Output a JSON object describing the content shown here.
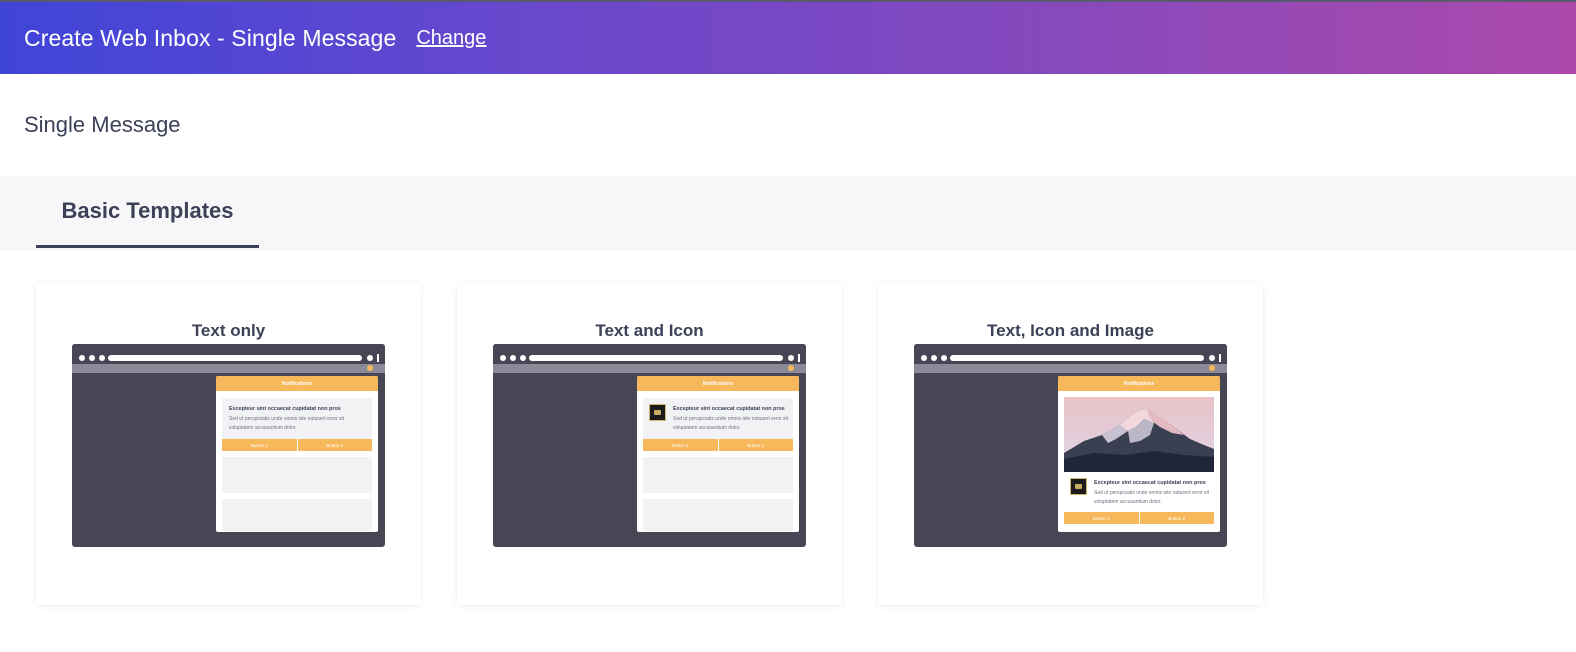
{
  "header": {
    "title": "Create Web Inbox - Single Message",
    "change_link": "Change"
  },
  "subheader": {
    "title": "Single Message"
  },
  "tabs": [
    {
      "label": "Basic Templates",
      "active": true
    }
  ],
  "templates": [
    {
      "title": "Text only"
    },
    {
      "title": "Text and Icon"
    },
    {
      "title": "Text, Icon and Image"
    }
  ],
  "preview": {
    "panel_title": "Notifications",
    "notification_title": "Excepteur sint occaecat cupidatat non pros",
    "notification_body": "Sed ut perspiciatis unde omnis iste natusert error sit voluptatem accusantium dolor.",
    "button_1": "Button 1",
    "button_2": "Button 2"
  },
  "colors": {
    "header_gradient_start": "#3f45d8",
    "header_gradient_end": "#ac49ab",
    "accent": "#f6b85a",
    "browser_frame": "#464655",
    "text": "#3d4157"
  }
}
